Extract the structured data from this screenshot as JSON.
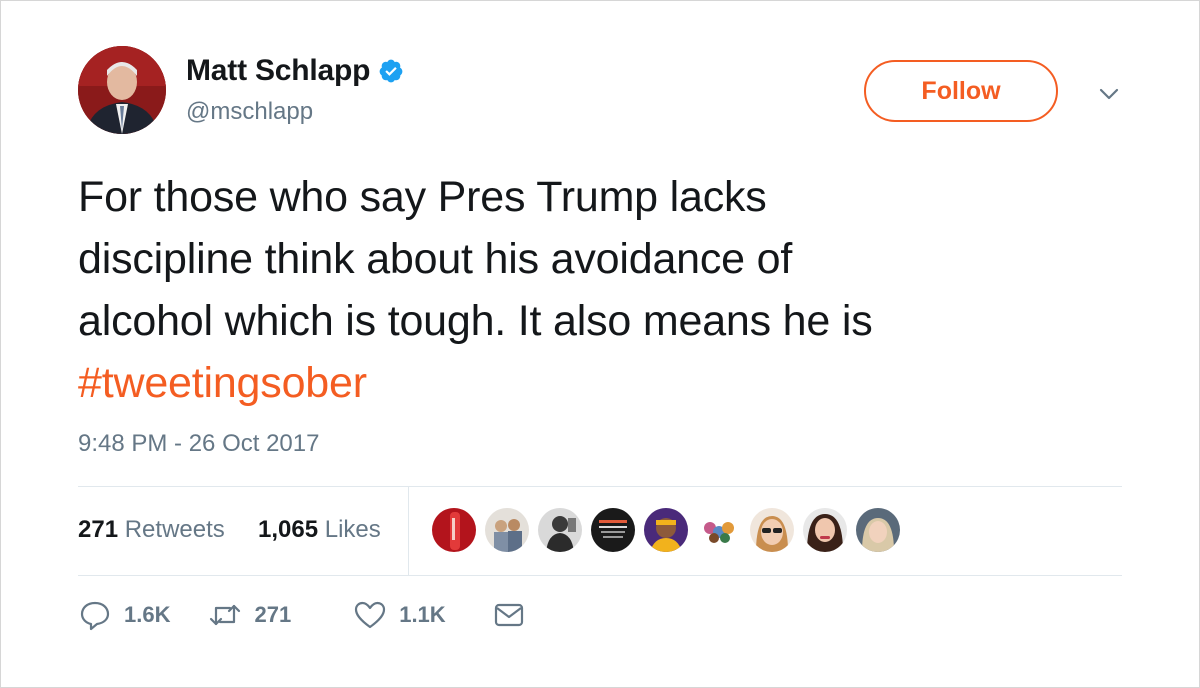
{
  "user": {
    "name": "Matt Schlapp",
    "handle": "@mschlapp"
  },
  "follow_label": "Follow",
  "tweet": {
    "text_lines": [
      "For those who say Pres Trump lacks",
      "discipline think about his avoidance of",
      "alcohol which is tough. It also means he is"
    ],
    "hashtag": "#tweetingsober",
    "timestamp": "9:48 PM - 26 Oct 2017"
  },
  "stats": {
    "retweets_count": "271",
    "retweets_label": "Retweets",
    "likes_count": "1,065",
    "likes_label": "Likes"
  },
  "actions": {
    "reply_count": "1.6K",
    "retweet_count": "271",
    "like_count": "1.1K"
  },
  "colors": {
    "accent": "#f45d22",
    "verified": "#1da1f2",
    "secondary_text": "#657786"
  },
  "icons": [
    "verified-badge-icon",
    "caret-down-icon",
    "reply-icon",
    "retweet-icon",
    "heart-icon",
    "envelope-icon"
  ]
}
